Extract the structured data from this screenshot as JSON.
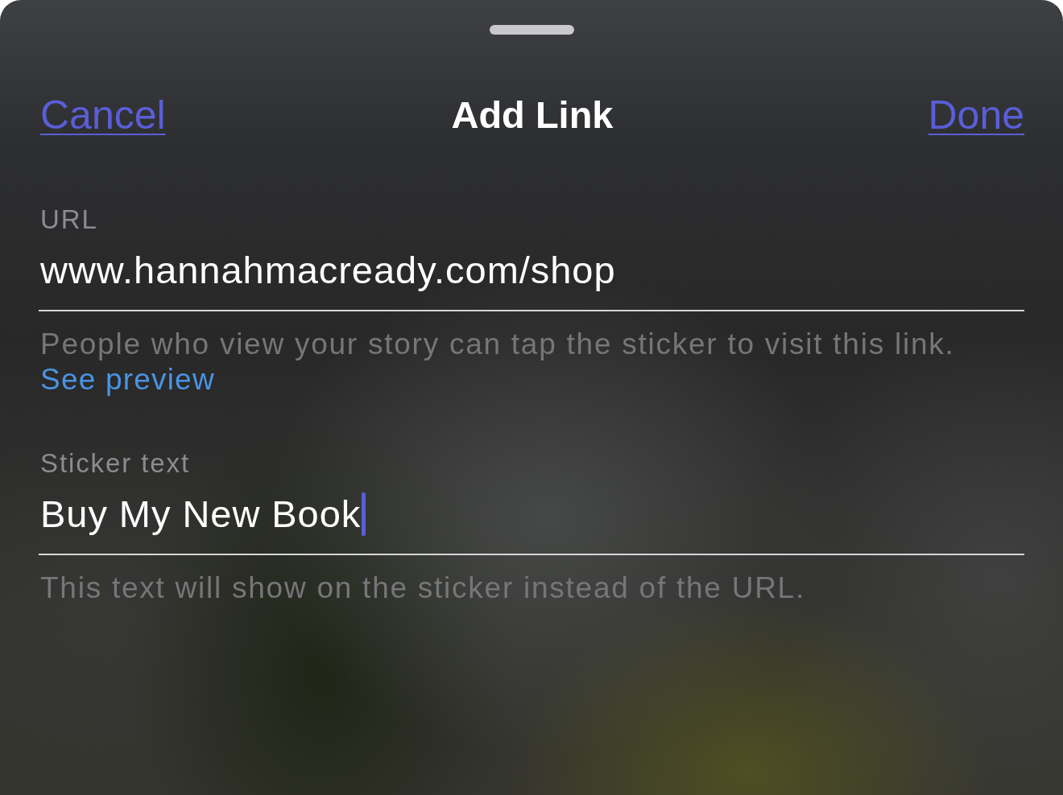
{
  "header": {
    "cancel": "Cancel",
    "title": "Add Link",
    "done": "Done"
  },
  "fields": [
    {
      "label": "URL",
      "value": "www.hannahmacready.com/shop",
      "focused": false,
      "help": "People who view your story can tap the sticker to visit this link.",
      "link": "See preview"
    },
    {
      "label": "Sticker text",
      "value": "Buy My New Book",
      "focused": true,
      "help": "This text will show on the sticker instead of the URL."
    }
  ]
}
